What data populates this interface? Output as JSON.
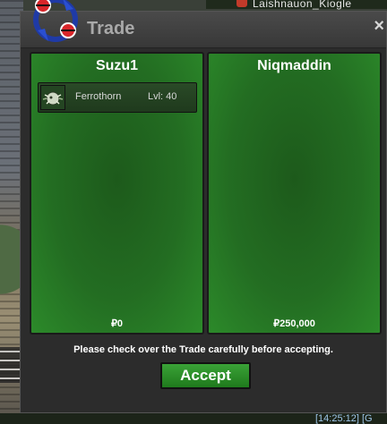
{
  "window": {
    "title": "Trade",
    "close_label": "×"
  },
  "background": {
    "top_text": "Laishnauon_Kiogle",
    "clock": "[14:25:12] [G"
  },
  "left_panel": {
    "player_name": "Suzu1",
    "items": [
      {
        "name": "Ferrothorn",
        "level": "Lvl: 40"
      }
    ],
    "money": "₽0"
  },
  "right_panel": {
    "player_name": "Niqmaddin",
    "items": [],
    "money": "₽250,000"
  },
  "notice": "Please check over the Trade carefully before accepting.",
  "accept_label": "Accept",
  "colors": {
    "panel_green": "#236d22",
    "button_green": "#2f8e2c",
    "title_gray": "#a9a9a9"
  }
}
